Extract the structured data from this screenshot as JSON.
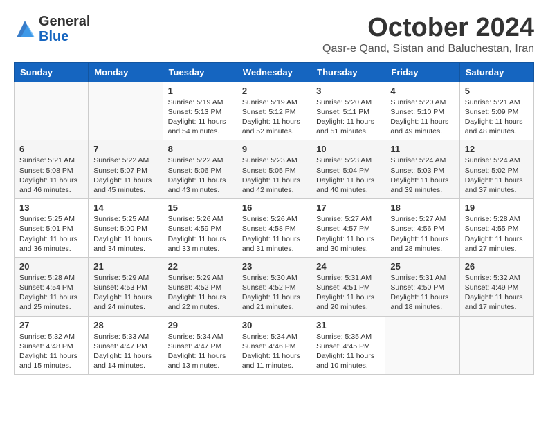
{
  "header": {
    "logo": {
      "general": "General",
      "blue": "Blue"
    },
    "month": "October 2024",
    "location": "Qasr-e Qand, Sistan and Baluchestan, Iran"
  },
  "weekdays": [
    "Sunday",
    "Monday",
    "Tuesday",
    "Wednesday",
    "Thursday",
    "Friday",
    "Saturday"
  ],
  "weeks": [
    [
      {
        "day": "",
        "sunrise": "",
        "sunset": "",
        "daylight": ""
      },
      {
        "day": "",
        "sunrise": "",
        "sunset": "",
        "daylight": ""
      },
      {
        "day": "1",
        "sunrise": "Sunrise: 5:19 AM",
        "sunset": "Sunset: 5:13 PM",
        "daylight": "Daylight: 11 hours and 54 minutes."
      },
      {
        "day": "2",
        "sunrise": "Sunrise: 5:19 AM",
        "sunset": "Sunset: 5:12 PM",
        "daylight": "Daylight: 11 hours and 52 minutes."
      },
      {
        "day": "3",
        "sunrise": "Sunrise: 5:20 AM",
        "sunset": "Sunset: 5:11 PM",
        "daylight": "Daylight: 11 hours and 51 minutes."
      },
      {
        "day": "4",
        "sunrise": "Sunrise: 5:20 AM",
        "sunset": "Sunset: 5:10 PM",
        "daylight": "Daylight: 11 hours and 49 minutes."
      },
      {
        "day": "5",
        "sunrise": "Sunrise: 5:21 AM",
        "sunset": "Sunset: 5:09 PM",
        "daylight": "Daylight: 11 hours and 48 minutes."
      }
    ],
    [
      {
        "day": "6",
        "sunrise": "Sunrise: 5:21 AM",
        "sunset": "Sunset: 5:08 PM",
        "daylight": "Daylight: 11 hours and 46 minutes."
      },
      {
        "day": "7",
        "sunrise": "Sunrise: 5:22 AM",
        "sunset": "Sunset: 5:07 PM",
        "daylight": "Daylight: 11 hours and 45 minutes."
      },
      {
        "day": "8",
        "sunrise": "Sunrise: 5:22 AM",
        "sunset": "Sunset: 5:06 PM",
        "daylight": "Daylight: 11 hours and 43 minutes."
      },
      {
        "day": "9",
        "sunrise": "Sunrise: 5:23 AM",
        "sunset": "Sunset: 5:05 PM",
        "daylight": "Daylight: 11 hours and 42 minutes."
      },
      {
        "day": "10",
        "sunrise": "Sunrise: 5:23 AM",
        "sunset": "Sunset: 5:04 PM",
        "daylight": "Daylight: 11 hours and 40 minutes."
      },
      {
        "day": "11",
        "sunrise": "Sunrise: 5:24 AM",
        "sunset": "Sunset: 5:03 PM",
        "daylight": "Daylight: 11 hours and 39 minutes."
      },
      {
        "day": "12",
        "sunrise": "Sunrise: 5:24 AM",
        "sunset": "Sunset: 5:02 PM",
        "daylight": "Daylight: 11 hours and 37 minutes."
      }
    ],
    [
      {
        "day": "13",
        "sunrise": "Sunrise: 5:25 AM",
        "sunset": "Sunset: 5:01 PM",
        "daylight": "Daylight: 11 hours and 36 minutes."
      },
      {
        "day": "14",
        "sunrise": "Sunrise: 5:25 AM",
        "sunset": "Sunset: 5:00 PM",
        "daylight": "Daylight: 11 hours and 34 minutes."
      },
      {
        "day": "15",
        "sunrise": "Sunrise: 5:26 AM",
        "sunset": "Sunset: 4:59 PM",
        "daylight": "Daylight: 11 hours and 33 minutes."
      },
      {
        "day": "16",
        "sunrise": "Sunrise: 5:26 AM",
        "sunset": "Sunset: 4:58 PM",
        "daylight": "Daylight: 11 hours and 31 minutes."
      },
      {
        "day": "17",
        "sunrise": "Sunrise: 5:27 AM",
        "sunset": "Sunset: 4:57 PM",
        "daylight": "Daylight: 11 hours and 30 minutes."
      },
      {
        "day": "18",
        "sunrise": "Sunrise: 5:27 AM",
        "sunset": "Sunset: 4:56 PM",
        "daylight": "Daylight: 11 hours and 28 minutes."
      },
      {
        "day": "19",
        "sunrise": "Sunrise: 5:28 AM",
        "sunset": "Sunset: 4:55 PM",
        "daylight": "Daylight: 11 hours and 27 minutes."
      }
    ],
    [
      {
        "day": "20",
        "sunrise": "Sunrise: 5:28 AM",
        "sunset": "Sunset: 4:54 PM",
        "daylight": "Daylight: 11 hours and 25 minutes."
      },
      {
        "day": "21",
        "sunrise": "Sunrise: 5:29 AM",
        "sunset": "Sunset: 4:53 PM",
        "daylight": "Daylight: 11 hours and 24 minutes."
      },
      {
        "day": "22",
        "sunrise": "Sunrise: 5:29 AM",
        "sunset": "Sunset: 4:52 PM",
        "daylight": "Daylight: 11 hours and 22 minutes."
      },
      {
        "day": "23",
        "sunrise": "Sunrise: 5:30 AM",
        "sunset": "Sunset: 4:52 PM",
        "daylight": "Daylight: 11 hours and 21 minutes."
      },
      {
        "day": "24",
        "sunrise": "Sunrise: 5:31 AM",
        "sunset": "Sunset: 4:51 PM",
        "daylight": "Daylight: 11 hours and 20 minutes."
      },
      {
        "day": "25",
        "sunrise": "Sunrise: 5:31 AM",
        "sunset": "Sunset: 4:50 PM",
        "daylight": "Daylight: 11 hours and 18 minutes."
      },
      {
        "day": "26",
        "sunrise": "Sunrise: 5:32 AM",
        "sunset": "Sunset: 4:49 PM",
        "daylight": "Daylight: 11 hours and 17 minutes."
      }
    ],
    [
      {
        "day": "27",
        "sunrise": "Sunrise: 5:32 AM",
        "sunset": "Sunset: 4:48 PM",
        "daylight": "Daylight: 11 hours and 15 minutes."
      },
      {
        "day": "28",
        "sunrise": "Sunrise: 5:33 AM",
        "sunset": "Sunset: 4:47 PM",
        "daylight": "Daylight: 11 hours and 14 minutes."
      },
      {
        "day": "29",
        "sunrise": "Sunrise: 5:34 AM",
        "sunset": "Sunset: 4:47 PM",
        "daylight": "Daylight: 11 hours and 13 minutes."
      },
      {
        "day": "30",
        "sunrise": "Sunrise: 5:34 AM",
        "sunset": "Sunset: 4:46 PM",
        "daylight": "Daylight: 11 hours and 11 minutes."
      },
      {
        "day": "31",
        "sunrise": "Sunrise: 5:35 AM",
        "sunset": "Sunset: 4:45 PM",
        "daylight": "Daylight: 11 hours and 10 minutes."
      },
      {
        "day": "",
        "sunrise": "",
        "sunset": "",
        "daylight": ""
      },
      {
        "day": "",
        "sunrise": "",
        "sunset": "",
        "daylight": ""
      }
    ]
  ]
}
